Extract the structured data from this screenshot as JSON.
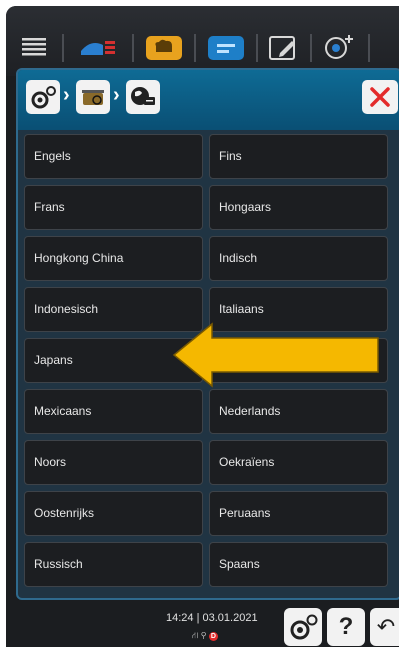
{
  "toolbar": {
    "icons": [
      "menu-icon",
      "cooking-modes-icon",
      "chef-hat-icon",
      "programs-icon",
      "edit-icon",
      "add-program-icon"
    ]
  },
  "dialog": {
    "breadcrumb": [
      "settings-gear-icon",
      "cooking-pot-settings-icon",
      "language-globe-icon"
    ],
    "close_label": "×",
    "items": [
      [
        "Engels",
        "Fins"
      ],
      [
        "Frans",
        "Hongaars"
      ],
      [
        "Hongkong China",
        "Indisch"
      ],
      [
        "Indonesisch",
        "Italiaans"
      ],
      [
        "Japans",
        ""
      ],
      [
        "Mexicaans",
        "Nederlands"
      ],
      [
        "Noors",
        "Oekraïens"
      ],
      [
        "Oostenrijks",
        "Peruaans"
      ],
      [
        "Russisch",
        "Spaans"
      ]
    ]
  },
  "status": {
    "time": "14:24",
    "date": "03.01.2021",
    "separator": "|",
    "indicators": "⛙ ⚲ D",
    "help_label": "?",
    "back_label": "↶"
  },
  "colors": {
    "accent_blue": "#0e6b95",
    "close_red": "#e32b2b",
    "arrow_yellow": "#f5b800"
  }
}
